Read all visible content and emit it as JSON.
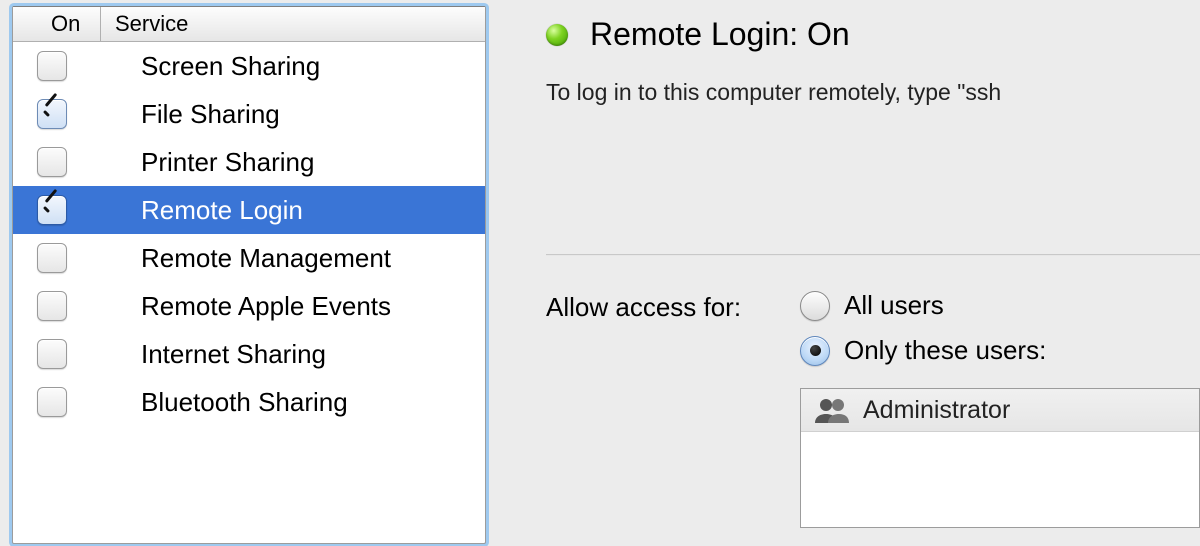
{
  "table": {
    "header_on": "On",
    "header_service": "Service",
    "rows": [
      {
        "label": "Screen Sharing",
        "checked": false,
        "selected": false
      },
      {
        "label": "File Sharing",
        "checked": true,
        "selected": false
      },
      {
        "label": "Printer Sharing",
        "checked": false,
        "selected": false
      },
      {
        "label": "Remote Login",
        "checked": true,
        "selected": true
      },
      {
        "label": "Remote Management",
        "checked": false,
        "selected": false
      },
      {
        "label": "Remote Apple Events",
        "checked": false,
        "selected": false
      },
      {
        "label": "Internet Sharing",
        "checked": false,
        "selected": false
      },
      {
        "label": "Bluetooth Sharing",
        "checked": false,
        "selected": false
      }
    ]
  },
  "detail": {
    "status_title": "Remote Login: On",
    "instruction": "To log in to this computer remotely, type \"ssh ",
    "access_label": "Allow access for:",
    "radios": {
      "all": "All users",
      "only": "Only these users:",
      "selected": "only"
    },
    "users": [
      {
        "label": "Administrator"
      }
    ]
  },
  "colors": {
    "selection": "#3a75d6",
    "led_green": "#7ed321"
  }
}
